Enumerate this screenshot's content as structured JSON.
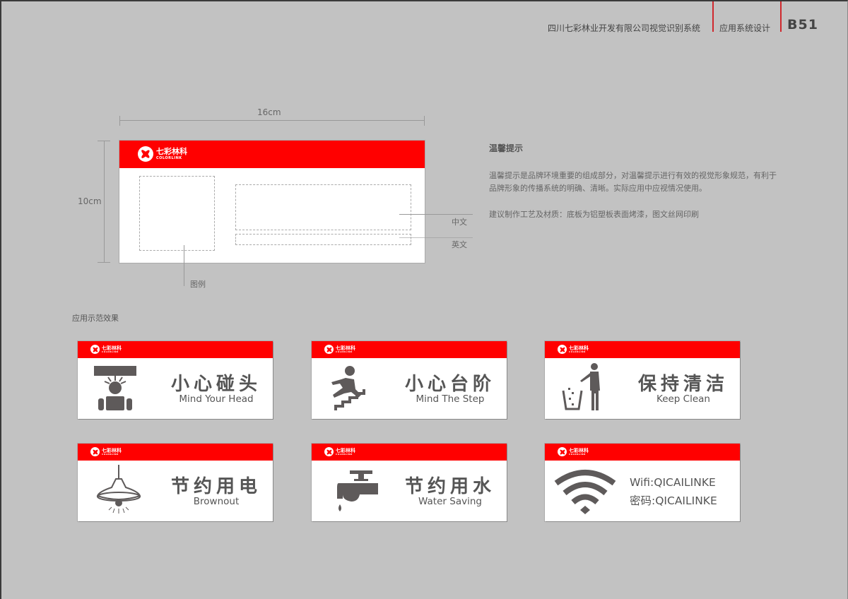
{
  "header": {
    "company": "四川七彩林业开发有限公司视觉识别系统",
    "section": "应用系统设计",
    "page": "B51",
    "accent_color": "#d0282d"
  },
  "spec": {
    "width_label": "16cm",
    "height_label": "10cm",
    "chinese_label": "中文",
    "english_label": "英文",
    "legend_label": "图例",
    "bar_color": "#ff0000"
  },
  "brand": {
    "logo_cn": "七彩林科",
    "logo_en": "COLORLINK",
    "logo_icon": "flower-logo-icon"
  },
  "description": {
    "title": "温馨提示",
    "body": "温馨提示是品牌环境重要的组成部分，对温馨提示进行有效的视觉形象规范，有利于品牌形象的传播系统的明确、清晰。实际应用中应视情况使用。",
    "note": "建议制作工艺及材质：底板为铝塑板表面烤漆，图文丝网印刷"
  },
  "examples": {
    "heading": "应用示范效果",
    "signs": [
      {
        "cn": "小心碰头",
        "en": "Mind Your Head",
        "icon": "mind-head-icon"
      },
      {
        "cn": "小心台阶",
        "en": "Mind The Step",
        "icon": "slip-stairs-icon"
      },
      {
        "cn": "保持清洁",
        "en": "Keep Clean",
        "icon": "trash-bin-icon"
      },
      {
        "cn": "节约用电",
        "en": "Brownout",
        "icon": "pendant-lamp-icon"
      },
      {
        "cn": "节约用水",
        "en": "Water Saving",
        "icon": "water-tap-icon"
      },
      {
        "wifi_line": "Wifi:QICAILINKE",
        "password_line": "密码:QICAILINKE",
        "icon": "wifi-icon"
      }
    ]
  }
}
